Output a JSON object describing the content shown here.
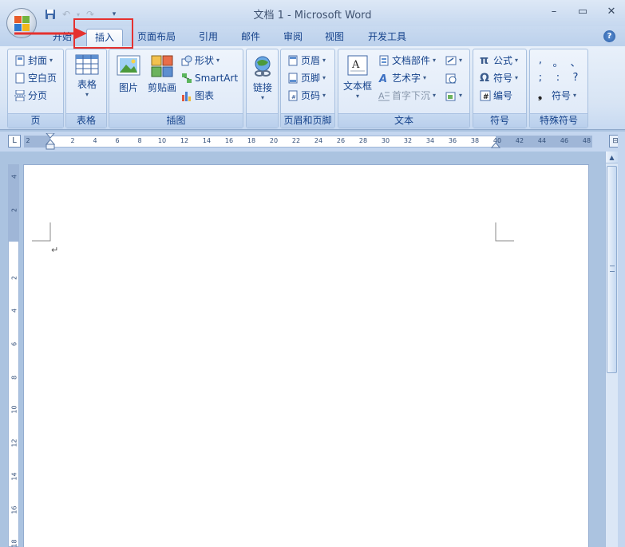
{
  "window": {
    "title": "文档 1 - Microsoft Word",
    "controls": [
      "minimize-icon",
      "maximize-icon",
      "close-icon"
    ]
  },
  "quick_access": [
    "save-icon",
    "undo-icon",
    "redo-icon",
    "customize-dropdown-icon"
  ],
  "tabs": [
    {
      "label": "开始",
      "active": false
    },
    {
      "label": "插入",
      "active": true
    },
    {
      "label": "页面布局",
      "active": false
    },
    {
      "label": "引用",
      "active": false
    },
    {
      "label": "邮件",
      "active": false
    },
    {
      "label": "审阅",
      "active": false
    },
    {
      "label": "视图",
      "active": false
    },
    {
      "label": "开发工具",
      "active": false
    }
  ],
  "help_label": "?",
  "annotation": {
    "box_color": "#e5312f",
    "arrow_color": "#e5312f"
  },
  "ribbon": {
    "pages": {
      "label": "页",
      "cover": "封面",
      "blank": "空白页",
      "break": "分页"
    },
    "tables": {
      "label": "表格",
      "table": "表格"
    },
    "illustrations": {
      "label": "插图",
      "picture": "图片",
      "clipart": "剪贴画",
      "shapes": "形状",
      "smartart": "SmartArt",
      "chart": "图表"
    },
    "links": {
      "label": "",
      "link": "链接"
    },
    "header_footer": {
      "label": "页眉和页脚",
      "header": "页眉",
      "footer": "页脚",
      "page_number": "页码"
    },
    "text": {
      "label": "文本",
      "textbox": "文本框",
      "quick_parts": "文档部件",
      "wordart": "艺术字",
      "dropcap": "首字下沉"
    },
    "symbols": {
      "label": "符号",
      "equation": "公式",
      "symbol": "符号",
      "numbering": "编号",
      "pi": "π",
      "omega": "Ω"
    },
    "special_symbols": {
      "label": "特殊符号",
      "row1": [
        ",",
        "。",
        "、"
      ],
      "row2": [
        ";",
        ":",
        "?"
      ],
      "symbol": "符号"
    }
  },
  "ruler": {
    "corner": "L",
    "h_ticks": [
      "2",
      "2",
      "4",
      "6",
      "8",
      "10",
      "12",
      "14",
      "16",
      "18",
      "20",
      "22",
      "24",
      "26",
      "28",
      "30",
      "32",
      "34",
      "36",
      "38",
      "40",
      "42",
      "44",
      "46",
      "48"
    ],
    "v_ticks": [
      "4",
      "2",
      "2",
      "4",
      "6",
      "8",
      "10",
      "12",
      "14",
      "16",
      "18"
    ]
  },
  "document": {
    "paragraph_mark": "↵"
  },
  "colors": {
    "accent": "#15428b",
    "ribbon": "#dde8f7",
    "page_bg": "#abc3e0"
  }
}
